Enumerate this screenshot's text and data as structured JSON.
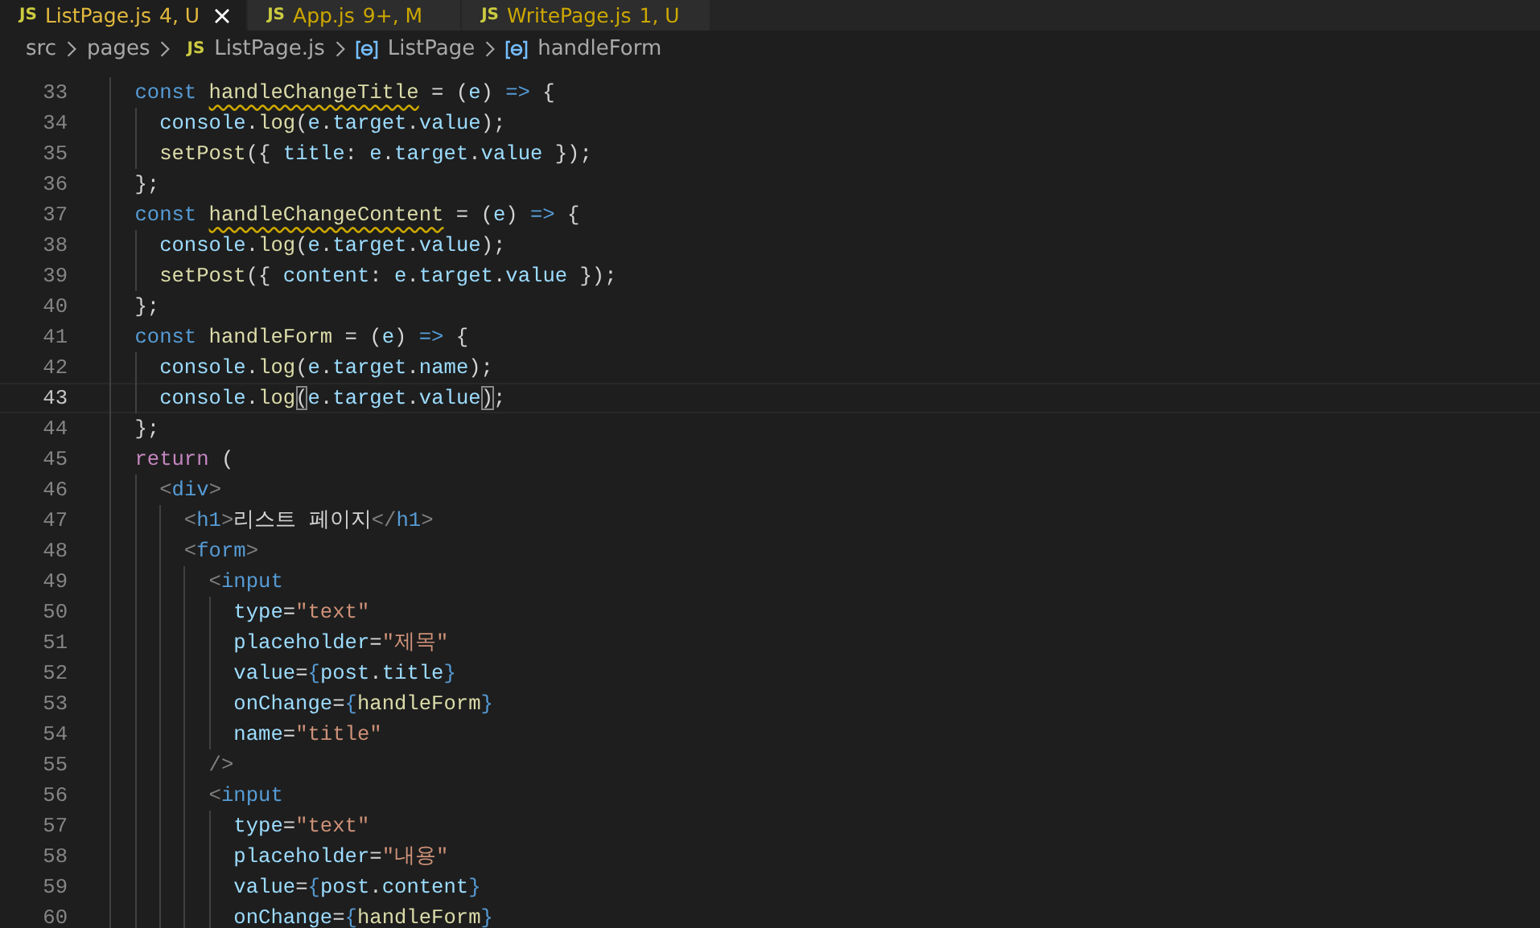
{
  "tabs": [
    {
      "icon": "JS",
      "label": "ListPage.js",
      "badge": "4, U",
      "selected": true
    },
    {
      "icon": "JS",
      "label": "App.js",
      "badge": "9+, M",
      "selected": false
    },
    {
      "icon": "JS",
      "label": "WritePage.js",
      "badge": "1, U",
      "selected": false
    }
  ],
  "breadcrumbs": [
    {
      "kind": "folder",
      "label": "src"
    },
    {
      "kind": "folder",
      "label": "pages"
    },
    {
      "kind": "file",
      "icon": "JS",
      "label": "ListPage.js"
    },
    {
      "kind": "symbol",
      "label": "ListPage"
    },
    {
      "kind": "symbol",
      "label": "handleForm"
    }
  ],
  "lines": [
    {
      "n": "33",
      "current": false,
      "tokens": [
        {
          "t": "    const ",
          "kind": "keyword"
        },
        {
          "t": "handleChangeTitle",
          "kind": "warning"
        },
        {
          "t": " = (",
          "kind": "punct"
        },
        {
          "t": "e",
          "kind": "variable"
        },
        {
          "t": ") ",
          "kind": "punct"
        },
        {
          "t": "=>",
          "kind": "keyword"
        },
        {
          "t": " {",
          "kind": "punct"
        }
      ]
    },
    {
      "n": "34",
      "current": false,
      "tokens": [
        {
          "t": "      console",
          "kind": "variable"
        },
        {
          "t": ".",
          "kind": "punct"
        },
        {
          "t": "log",
          "kind": "function"
        },
        {
          "t": "(",
          "kind": "punct"
        },
        {
          "t": "e",
          "kind": "variable"
        },
        {
          "t": ".",
          "kind": "punct"
        },
        {
          "t": "target",
          "kind": "variable"
        },
        {
          "t": ".",
          "kind": "punct"
        },
        {
          "t": "value",
          "kind": "variable"
        },
        {
          "t": ");",
          "kind": "punct"
        }
      ]
    },
    {
      "n": "35",
      "current": false,
      "tokens": [
        {
          "t": "      setPost",
          "kind": "function"
        },
        {
          "t": "({ ",
          "kind": "punct"
        },
        {
          "t": "title",
          "kind": "variable"
        },
        {
          "t": ": ",
          "kind": "punct"
        },
        {
          "t": "e",
          "kind": "variable"
        },
        {
          "t": ".",
          "kind": "punct"
        },
        {
          "t": "target",
          "kind": "variable"
        },
        {
          "t": ".",
          "kind": "punct"
        },
        {
          "t": "value",
          "kind": "variable"
        },
        {
          "t": " });",
          "kind": "punct"
        }
      ]
    },
    {
      "n": "36",
      "current": false,
      "tokens": [
        {
          "t": "    };",
          "kind": "punct"
        }
      ]
    },
    {
      "n": "37",
      "current": false,
      "tokens": [
        {
          "t": "    const ",
          "kind": "keyword"
        },
        {
          "t": "handleChangeContent",
          "kind": "warning"
        },
        {
          "t": " = (",
          "kind": "punct"
        },
        {
          "t": "e",
          "kind": "variable"
        },
        {
          "t": ") ",
          "kind": "punct"
        },
        {
          "t": "=>",
          "kind": "keyword"
        },
        {
          "t": " {",
          "kind": "punct"
        }
      ]
    },
    {
      "n": "38",
      "current": false,
      "tokens": [
        {
          "t": "      console",
          "kind": "variable"
        },
        {
          "t": ".",
          "kind": "punct"
        },
        {
          "t": "log",
          "kind": "function"
        },
        {
          "t": "(",
          "kind": "punct"
        },
        {
          "t": "e",
          "kind": "variable"
        },
        {
          "t": ".",
          "kind": "punct"
        },
        {
          "t": "target",
          "kind": "variable"
        },
        {
          "t": ".",
          "kind": "punct"
        },
        {
          "t": "value",
          "kind": "variable"
        },
        {
          "t": ");",
          "kind": "punct"
        }
      ]
    },
    {
      "n": "39",
      "current": false,
      "tokens": [
        {
          "t": "      setPost",
          "kind": "function"
        },
        {
          "t": "({ ",
          "kind": "punct"
        },
        {
          "t": "content",
          "kind": "variable"
        },
        {
          "t": ": ",
          "kind": "punct"
        },
        {
          "t": "e",
          "kind": "variable"
        },
        {
          "t": ".",
          "kind": "punct"
        },
        {
          "t": "target",
          "kind": "variable"
        },
        {
          "t": ".",
          "kind": "punct"
        },
        {
          "t": "value",
          "kind": "variable"
        },
        {
          "t": " });",
          "kind": "punct"
        }
      ]
    },
    {
      "n": "40",
      "current": false,
      "tokens": [
        {
          "t": "    };",
          "kind": "punct"
        }
      ]
    },
    {
      "n": "41",
      "current": false,
      "tokens": [
        {
          "t": "    const ",
          "kind": "keyword"
        },
        {
          "t": "handleForm",
          "kind": "function"
        },
        {
          "t": " = (",
          "kind": "punct"
        },
        {
          "t": "e",
          "kind": "variable"
        },
        {
          "t": ") ",
          "kind": "punct"
        },
        {
          "t": "=>",
          "kind": "keyword"
        },
        {
          "t": " {",
          "kind": "punct"
        }
      ]
    },
    {
      "n": "42",
      "current": false,
      "tokens": [
        {
          "t": "      console",
          "kind": "variable"
        },
        {
          "t": ".",
          "kind": "punct"
        },
        {
          "t": "log",
          "kind": "function"
        },
        {
          "t": "(",
          "kind": "punct"
        },
        {
          "t": "e",
          "kind": "variable"
        },
        {
          "t": ".",
          "kind": "punct"
        },
        {
          "t": "target",
          "kind": "variable"
        },
        {
          "t": ".",
          "kind": "punct"
        },
        {
          "t": "name",
          "kind": "variable"
        },
        {
          "t": ");",
          "kind": "punct"
        }
      ]
    },
    {
      "n": "43",
      "current": true,
      "tokens": [
        {
          "t": "      console",
          "kind": "variable"
        },
        {
          "t": ".",
          "kind": "punct"
        },
        {
          "t": "log",
          "kind": "function"
        },
        {
          "t": "(",
          "kind": "match"
        },
        {
          "t": "e",
          "kind": "variable"
        },
        {
          "t": ".",
          "kind": "punct"
        },
        {
          "t": "target",
          "kind": "variable"
        },
        {
          "t": ".",
          "kind": "punct"
        },
        {
          "t": "value",
          "kind": "variable"
        },
        {
          "t": ")",
          "kind": "match"
        },
        {
          "t": ";",
          "kind": "punct"
        }
      ]
    },
    {
      "n": "44",
      "current": false,
      "tokens": [
        {
          "t": "    };",
          "kind": "punct"
        }
      ]
    },
    {
      "n": "45",
      "current": false,
      "tokens": [
        {
          "t": "    return",
          "kind": "control"
        },
        {
          "t": " (",
          "kind": "punct"
        }
      ]
    },
    {
      "n": "46",
      "current": false,
      "tokens": [
        {
          "t": "      <",
          "kind": "tag"
        },
        {
          "t": "div",
          "kind": "keyword"
        },
        {
          "t": ">",
          "kind": "tag"
        }
      ]
    },
    {
      "n": "47",
      "current": false,
      "tokens": [
        {
          "t": "        <",
          "kind": "tag"
        },
        {
          "t": "h1",
          "kind": "keyword"
        },
        {
          "t": ">",
          "kind": "tag"
        },
        {
          "t": "리스트 페이지",
          "kind": "punct"
        },
        {
          "t": "</",
          "kind": "tag"
        },
        {
          "t": "h1",
          "kind": "keyword"
        },
        {
          "t": ">",
          "kind": "tag"
        }
      ]
    },
    {
      "n": "48",
      "current": false,
      "tokens": [
        {
          "t": "        <",
          "kind": "tag"
        },
        {
          "t": "form",
          "kind": "keyword"
        },
        {
          "t": ">",
          "kind": "tag"
        }
      ]
    },
    {
      "n": "49",
      "current": false,
      "tokens": [
        {
          "t": "          <",
          "kind": "tag"
        },
        {
          "t": "input",
          "kind": "keyword"
        }
      ]
    },
    {
      "n": "50",
      "current": false,
      "tokens": [
        {
          "t": "            type",
          "kind": "variable"
        },
        {
          "t": "=",
          "kind": "punct"
        },
        {
          "t": "\"text\"",
          "kind": "string"
        }
      ]
    },
    {
      "n": "51",
      "current": false,
      "tokens": [
        {
          "t": "            placeholder",
          "kind": "variable"
        },
        {
          "t": "=",
          "kind": "punct"
        },
        {
          "t": "\"제목\"",
          "kind": "string"
        }
      ]
    },
    {
      "n": "52",
      "current": false,
      "tokens": [
        {
          "t": "            value",
          "kind": "variable"
        },
        {
          "t": "=",
          "kind": "punct"
        },
        {
          "t": "{",
          "kind": "keyword"
        },
        {
          "t": "post",
          "kind": "variable"
        },
        {
          "t": ".",
          "kind": "punct"
        },
        {
          "t": "title",
          "kind": "variable"
        },
        {
          "t": "}",
          "kind": "keyword"
        }
      ]
    },
    {
      "n": "53",
      "current": false,
      "tokens": [
        {
          "t": "            onChange",
          "kind": "variable"
        },
        {
          "t": "=",
          "kind": "punct"
        },
        {
          "t": "{",
          "kind": "keyword"
        },
        {
          "t": "handleForm",
          "kind": "function"
        },
        {
          "t": "}",
          "kind": "keyword"
        }
      ]
    },
    {
      "n": "54",
      "current": false,
      "tokens": [
        {
          "t": "            name",
          "kind": "variable"
        },
        {
          "t": "=",
          "kind": "punct"
        },
        {
          "t": "\"title\"",
          "kind": "string"
        }
      ]
    },
    {
      "n": "55",
      "current": false,
      "tokens": [
        {
          "t": "          />",
          "kind": "tag"
        }
      ]
    },
    {
      "n": "56",
      "current": false,
      "tokens": [
        {
          "t": "          <",
          "kind": "tag"
        },
        {
          "t": "input",
          "kind": "keyword"
        }
      ]
    },
    {
      "n": "57",
      "current": false,
      "tokens": [
        {
          "t": "            type",
          "kind": "variable"
        },
        {
          "t": "=",
          "kind": "punct"
        },
        {
          "t": "\"text\"",
          "kind": "string"
        }
      ]
    },
    {
      "n": "58",
      "current": false,
      "tokens": [
        {
          "t": "            placeholder",
          "kind": "variable"
        },
        {
          "t": "=",
          "kind": "punct"
        },
        {
          "t": "\"내용\"",
          "kind": "string"
        }
      ]
    },
    {
      "n": "59",
      "current": false,
      "tokens": [
        {
          "t": "            value",
          "kind": "variable"
        },
        {
          "t": "=",
          "kind": "punct"
        },
        {
          "t": "{",
          "kind": "keyword"
        },
        {
          "t": "post",
          "kind": "variable"
        },
        {
          "t": ".",
          "kind": "punct"
        },
        {
          "t": "content",
          "kind": "variable"
        },
        {
          "t": "}",
          "kind": "keyword"
        }
      ]
    },
    {
      "n": "60",
      "current": false,
      "tokens": [
        {
          "t": "            onChange",
          "kind": "variable"
        },
        {
          "t": "=",
          "kind": "punct"
        },
        {
          "t": "{",
          "kind": "keyword"
        },
        {
          "t": "handleForm",
          "kind": "function"
        },
        {
          "t": "}",
          "kind": "keyword"
        }
      ]
    }
  ]
}
